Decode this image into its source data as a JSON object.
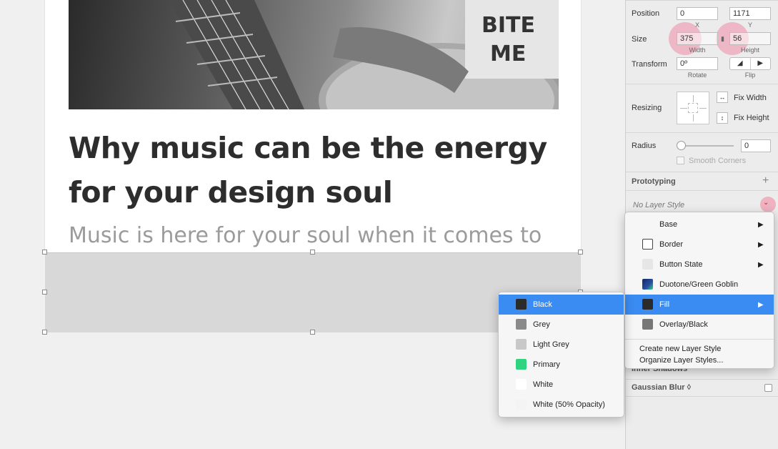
{
  "canvas": {
    "headline": "Why music can be the energy for your design soul",
    "subtext": "Music is here for your soul when it comes to",
    "photo_text": "BITE ME"
  },
  "inspector": {
    "position": {
      "label": "Position",
      "x": "0",
      "y": "1171",
      "x_label": "X",
      "y_label": "Y"
    },
    "size": {
      "label": "Size",
      "width": "375",
      "height": "56",
      "width_label": "Width",
      "height_label": "Height"
    },
    "transform": {
      "label": "Transform",
      "rotate": "0º",
      "rotate_label": "Rotate",
      "flip_label": "Flip"
    },
    "resizing": {
      "label": "Resizing",
      "fix_width": "Fix Width",
      "fix_height": "Fix Height"
    },
    "radius": {
      "label": "Radius",
      "value": "0",
      "smooth_corners": "Smooth Corners"
    },
    "prototyping": "Prototyping",
    "layer_style": "No Layer Style",
    "inner_shadows": "Inner Shadows",
    "gaussian_blur": "Gaussian Blur ◊"
  },
  "style_menu": {
    "items": [
      {
        "label": "Base",
        "swatch": "",
        "has_submenu": true
      },
      {
        "label": "Border",
        "swatch": "#ffffff",
        "swatch_border": true,
        "has_submenu": true
      },
      {
        "label": "Button State",
        "swatch": "#e6e6e6",
        "has_submenu": true
      },
      {
        "label": "Duotone/Green Goblin",
        "swatch": "#1f2f6b",
        "has_submenu": false
      },
      {
        "label": "Fill",
        "swatch": "#2b2b2b",
        "has_submenu": true,
        "selected": true
      },
      {
        "label": "Overlay/Black",
        "swatch": "#777777",
        "has_submenu": false
      }
    ],
    "actions": [
      "Create new Layer Style",
      "Organize Layer Styles..."
    ]
  },
  "fill_submenu": {
    "items": [
      {
        "label": "Black",
        "swatch": "#2b2b2b",
        "selected": true
      },
      {
        "label": "Grey",
        "swatch": "#8a8a8a"
      },
      {
        "label": "Light Grey",
        "swatch": "#c8c8c8"
      },
      {
        "label": "Primary",
        "swatch": "#2fd47f"
      },
      {
        "label": "White",
        "swatch": "#ffffff"
      },
      {
        "label": "White (50% Opacity)",
        "swatch": "#f4f4f4"
      }
    ]
  }
}
